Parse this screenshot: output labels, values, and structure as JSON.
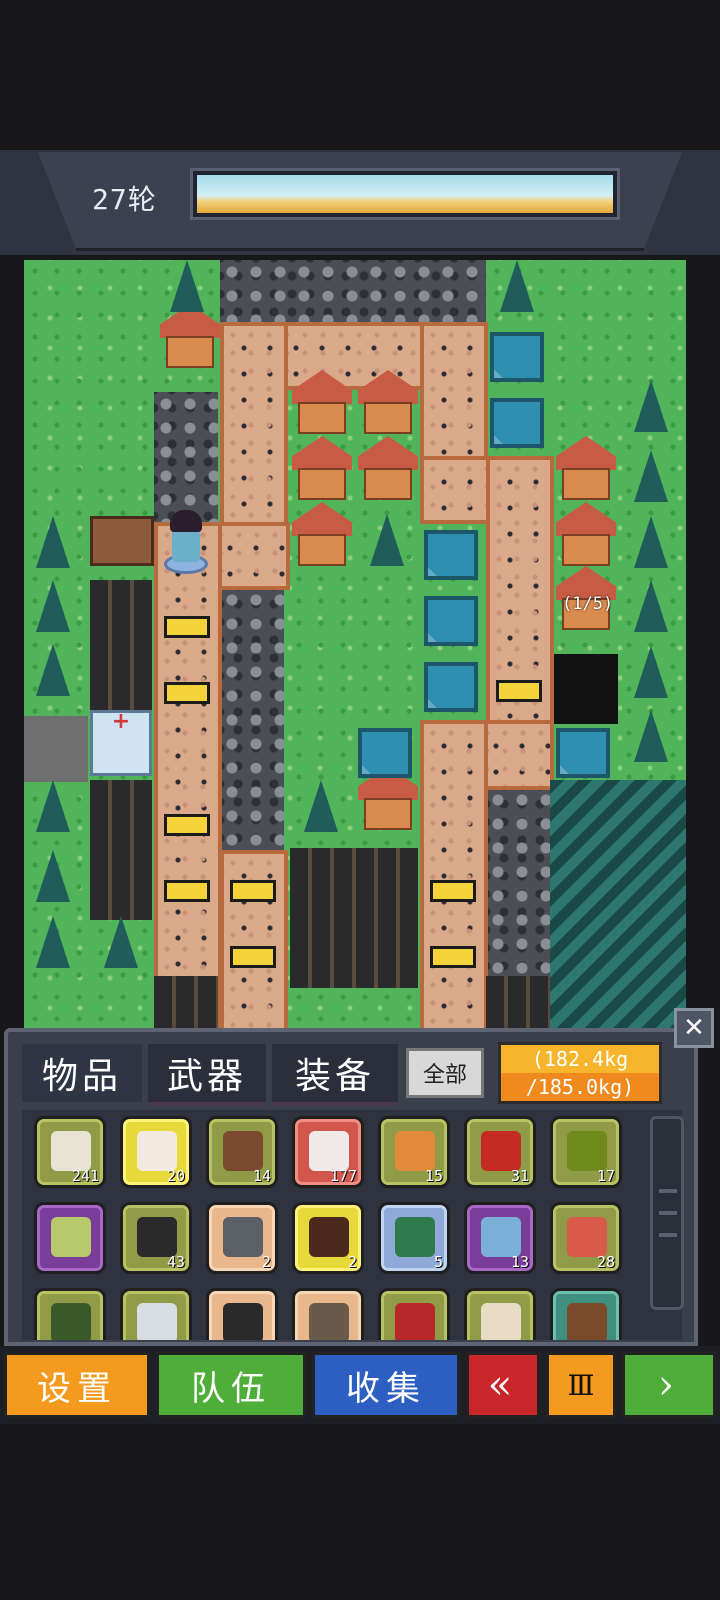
{
  "hud": {
    "round_label": "27轮"
  },
  "map": {
    "building_counter": "(1/5)"
  },
  "inventory": {
    "tabs": [
      "物品",
      "武器",
      "装备"
    ],
    "filter_all": "全部",
    "weight_current": "(182.4kg",
    "weight_max": "/185.0kg)",
    "items": [
      {
        "icon": "supplies-bottle-icon",
        "count": "241",
        "rarity": "olive"
      },
      {
        "icon": "medicine-syringe-icon",
        "count": "20",
        "rarity": "yellow"
      },
      {
        "icon": "chocolate-bar-icon",
        "count": "14",
        "rarity": "olive"
      },
      {
        "icon": "medkit-bandage-icon",
        "count": "177",
        "rarity": "red"
      },
      {
        "icon": "bread-icon",
        "count": "15",
        "rarity": "olive"
      },
      {
        "icon": "chili-pepper-icon",
        "count": "31",
        "rarity": "olive"
      },
      {
        "icon": "apple-icon",
        "count": "17",
        "rarity": "olive"
      },
      {
        "icon": "canned-food-icon",
        "count": "",
        "rarity": "purple"
      },
      {
        "icon": "boots-icon",
        "count": "43",
        "rarity": "olive"
      },
      {
        "icon": "rifle-icon",
        "count": "2",
        "rarity": "peach"
      },
      {
        "icon": "liquor-bottle-icon",
        "count": "2",
        "rarity": "yellow"
      },
      {
        "icon": "circuit-board-icon",
        "count": "5",
        "rarity": "blue"
      },
      {
        "icon": "shirt-icon",
        "count": "13",
        "rarity": "purple"
      },
      {
        "icon": "meat-can-icon",
        "count": "28",
        "rarity": "olive"
      },
      {
        "icon": "herb-leaf-icon",
        "count": "",
        "rarity": "olive"
      },
      {
        "icon": "cloth-icon",
        "count": "",
        "rarity": "olive"
      },
      {
        "icon": "rope-icon",
        "count": "",
        "rarity": "peach"
      },
      {
        "icon": "stone-icon",
        "count": "",
        "rarity": "peach"
      },
      {
        "icon": "raw-meat-icon",
        "count": "",
        "rarity": "olive"
      },
      {
        "icon": "egg-icon",
        "count": "",
        "rarity": "olive"
      },
      {
        "icon": "wood-log-icon",
        "count": "",
        "rarity": "teal"
      }
    ]
  },
  "bottom_bar": {
    "settings": "设置",
    "team": "队伍",
    "collect": "收集",
    "rewind": "«",
    "pause": "Ⅲ",
    "play": "›"
  },
  "colors": {
    "settings": "#f39a1f",
    "team": "#4fae3a",
    "collect": "#2d5fc2",
    "rewind": "#c8262b",
    "pause": "#f39a1f",
    "play": "#4fae3a"
  }
}
